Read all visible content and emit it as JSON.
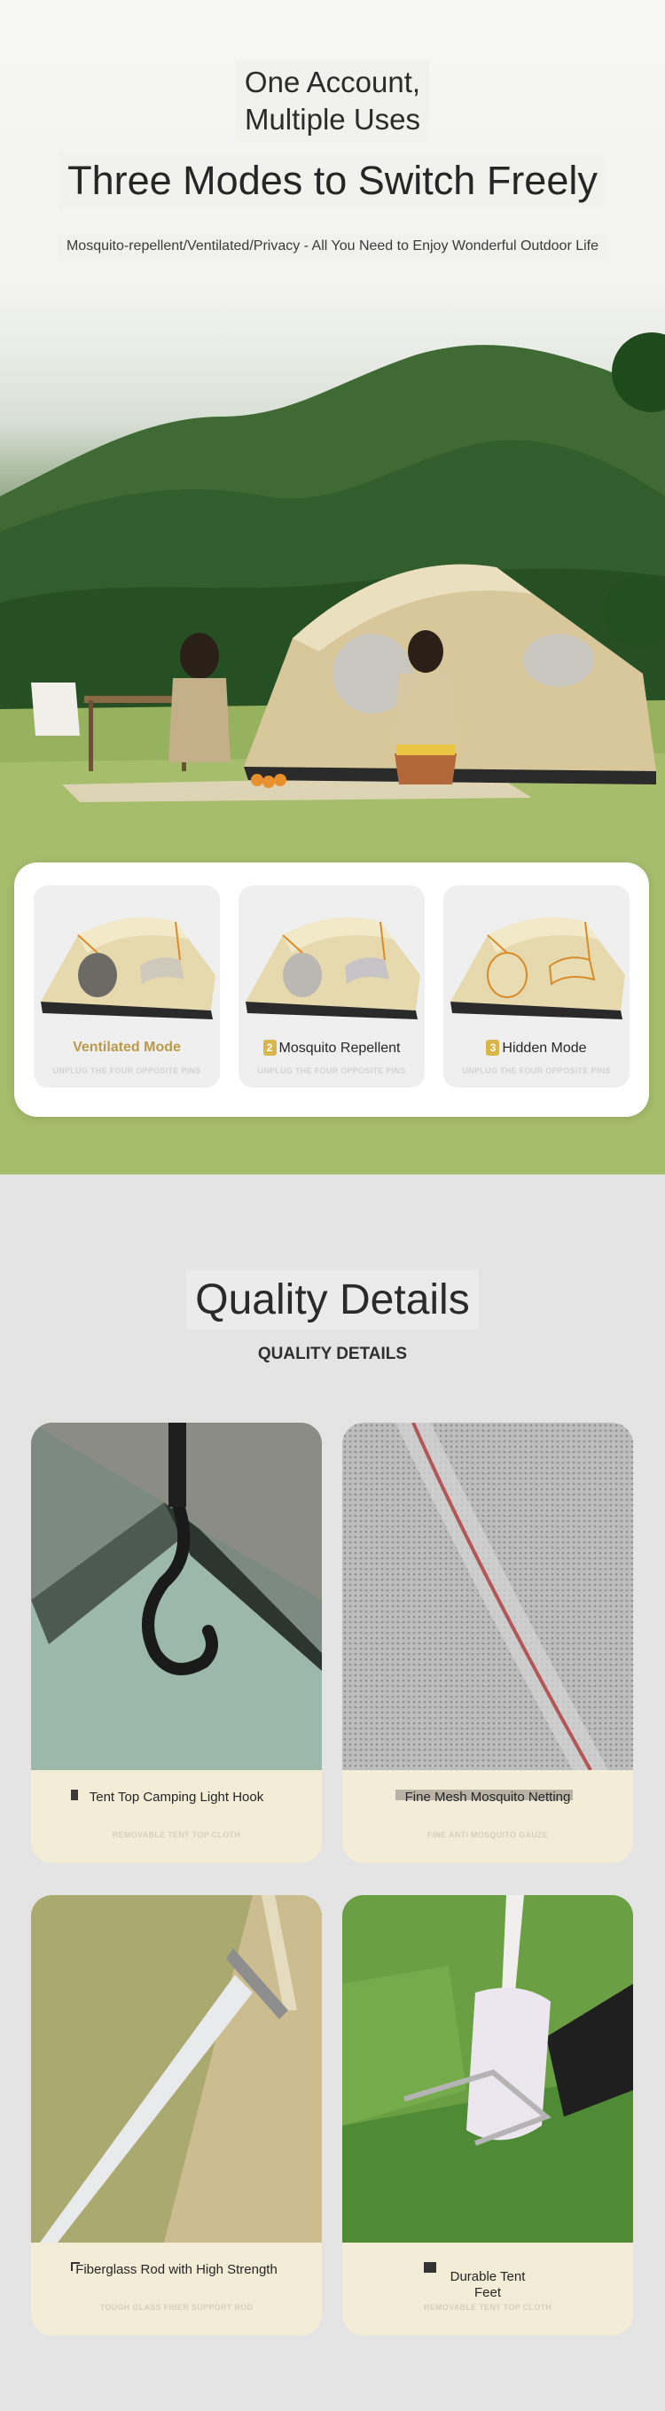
{
  "hero": {
    "title_line1": "One Account,",
    "title_line2": "Multiple Uses",
    "headline": "Three Modes to Switch Freely",
    "subtitle": "Mosquito-repellent/Ventilated/Privacy - All You Need to Enjoy Wonderful Outdoor Life"
  },
  "modes": [
    {
      "label": "Ventilated Mode",
      "number": "",
      "caption": "UNPLUG THE FOUR OPPOSITE PINS"
    },
    {
      "label": "Mosquito Repellent",
      "number": "2",
      "caption": "UNPLUG THE FOUR OPPOSITE PINS"
    },
    {
      "label": "Hidden Mode",
      "number": "3",
      "caption": "UNPLUG THE FOUR OPPOSITE PINS"
    }
  ],
  "quality": {
    "title": "Quality Details",
    "subtitle": "QUALITY DETAILS",
    "items": [
      {
        "label": "Tent Top Camping Light Hook",
        "caption": "REMOVABLE TENT TOP CLOTH"
      },
      {
        "label": "Fine Mesh Mosquito Netting",
        "caption": "FINE ANTI MOSQUITO GAUZE"
      },
      {
        "label": "Fiberglass Rod with High Strength",
        "caption": "TOUGH GLASS FIBER SUPPORT ROD"
      },
      {
        "label_line1": "Durable Tent",
        "label_line2": "Feet",
        "caption": "REMOVABLE TENT TOP CLOTH"
      }
    ]
  },
  "colors": {
    "accent_gold": "#b99a4a",
    "badge_gold": "#d9b54a",
    "card_cream": "#f3ecd7",
    "tent_beige": "#e8dcb3"
  }
}
